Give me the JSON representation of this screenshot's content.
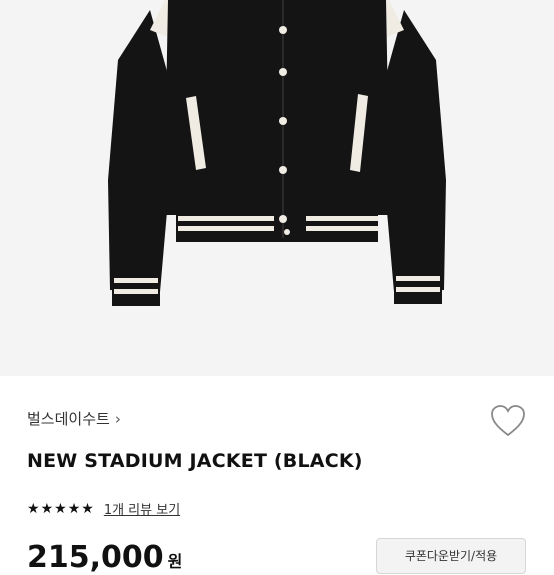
{
  "product": {
    "image_alt": "black stadium jacket with white trim",
    "brand": "벌스데이수트",
    "name": "NEW STADIUM JACKET (BLACK)",
    "rating_stars": 5,
    "review_link": "1개 리뷰 보기",
    "price": "215,000",
    "price_unit": "원",
    "coupon_button": "쿠폰다운받기/적용"
  },
  "icons": {
    "brand_chevron": "chevron-right-icon",
    "wishlist": "heart-outline-icon",
    "star": "star-icon"
  },
  "colors": {
    "jacket": "#141414",
    "trim": "#f1ece3",
    "background": "#f4f4f4"
  }
}
